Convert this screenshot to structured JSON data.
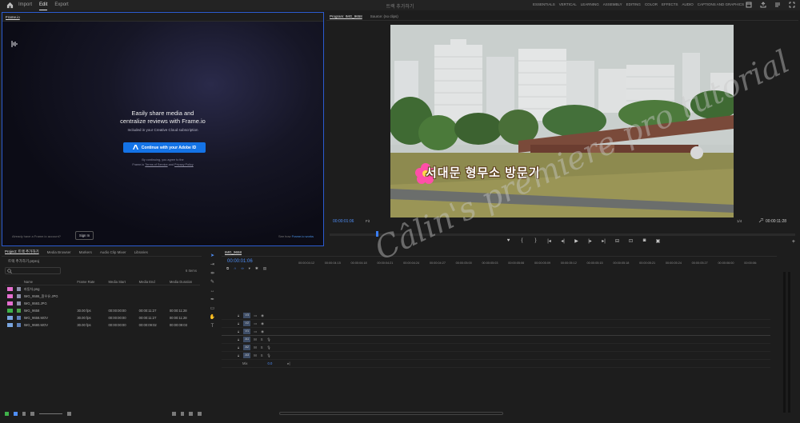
{
  "topbar": {
    "tabs": [
      "Import",
      "Edit",
      "Export"
    ],
    "active_tab": "Edit",
    "title": "트랙 추가하기",
    "workspaces": [
      "ESSENTIALS",
      "VERTICAL",
      "LEARNING",
      "ASSEMBLY",
      "EDITING",
      "COLOR",
      "EFFECTS",
      "AUDIO",
      "CAPTIONS AND GRAPHICS"
    ]
  },
  "frameio": {
    "tab": "Frame.io",
    "headline_1": "Easily share media and",
    "headline_2": "centralize reviews with Frame.io",
    "subtitle": "Included in your Creative Cloud subscription",
    "button": "Continue with your Adobe ID",
    "legal_1": "By continuing, you agree to the",
    "legal_2a": "Frame.io",
    "legal_2b": "Terms of Service",
    "legal_2c": "and",
    "legal_2d": "Privacy Policy",
    "bottom_left": "Already have a Frame.io account?",
    "signin": "Sign In",
    "bottom_right_a": "See how",
    "bottom_right_b": "Frame.io works"
  },
  "program": {
    "tab_program": "Program: IMG_9658",
    "tab_source": "Source: (no clips)",
    "caption": "서대문 형무소 방문기",
    "timecode_current": "00:00:01:06",
    "fit": "Fit",
    "quality": "1/4",
    "timecode_duration": "00:00:11:28"
  },
  "project": {
    "tabs": [
      "Project: 트랙 추가하기",
      "Media Browser",
      "Markers",
      "Audio Clip Mixer",
      "Libraries"
    ],
    "bin": "트랙 추가하기.prproj",
    "items_count": "6 Items",
    "columns": [
      "Name",
      "Frame Rate",
      "Media Start",
      "Media End",
      "Media Duration"
    ],
    "rows": [
      {
        "name": "자동차.png",
        "fr": "",
        "ms": "",
        "me": "",
        "md": "",
        "color": "#e46fd0",
        "icon": "#8b8fa8"
      },
      {
        "name": "IMG_9586_흰우유.JPG",
        "fr": "",
        "ms": "",
        "me": "",
        "md": "",
        "color": "#e46fd0",
        "icon": "#8b8fa8"
      },
      {
        "name": "IMG_9593.JPG",
        "fr": "",
        "ms": "",
        "me": "",
        "md": "",
        "color": "#e46fd0",
        "icon": "#8b8fa8"
      },
      {
        "name": "IMG_9658",
        "fr": "30.00 fps",
        "ms": "00:00:00:00",
        "me": "00:00:11:27",
        "md": "00:00:11:28",
        "color": "#3fb24a",
        "icon": "#4aa34a"
      },
      {
        "name": "IMG_9658.MOV",
        "fr": "30.00 fps",
        "ms": "00:00:00:00",
        "me": "00:00:11:27",
        "md": "00:00:11:28",
        "color": "#7aa6e0",
        "icon": "#5d7fb6"
      },
      {
        "name": "IMG_9680.MOV",
        "fr": "30.00 fps",
        "ms": "00:00:00:00",
        "me": "00:00:09:02",
        "md": "00:00:09:03",
        "color": "#7aa6e0",
        "icon": "#5d7fb6"
      }
    ]
  },
  "timeline": {
    "tab": "IMG_9658",
    "timecode": "00:00:01:06",
    "ruler": [
      "00:00:04:12",
      "00:00:04:15",
      "00:00:04:18",
      "00:00:04:21",
      "00:00:04:24",
      "00:00:04:27",
      "00:00:05:00",
      "00:00:05:03",
      "00:00:05:06",
      "00:00:05:09",
      "00:00:05:12",
      "00:00:05:15",
      "00:00:05:18",
      "00:00:05:21",
      "00:00:05:24",
      "00:00:05:27",
      "00:00:06:00",
      "00:00:06:"
    ],
    "video_tracks": [
      "V3",
      "V2",
      "V1"
    ],
    "audio_tracks": [
      "A1",
      "A2",
      "A3"
    ],
    "mix": "Mix",
    "mix_value": "0.0",
    "watermark": "Câlin's premiere pro tutorial"
  },
  "colors": {
    "accent": "#4f8ef7",
    "frameio_button": "#1473e6",
    "panel_bg": "#1d1d1d"
  }
}
